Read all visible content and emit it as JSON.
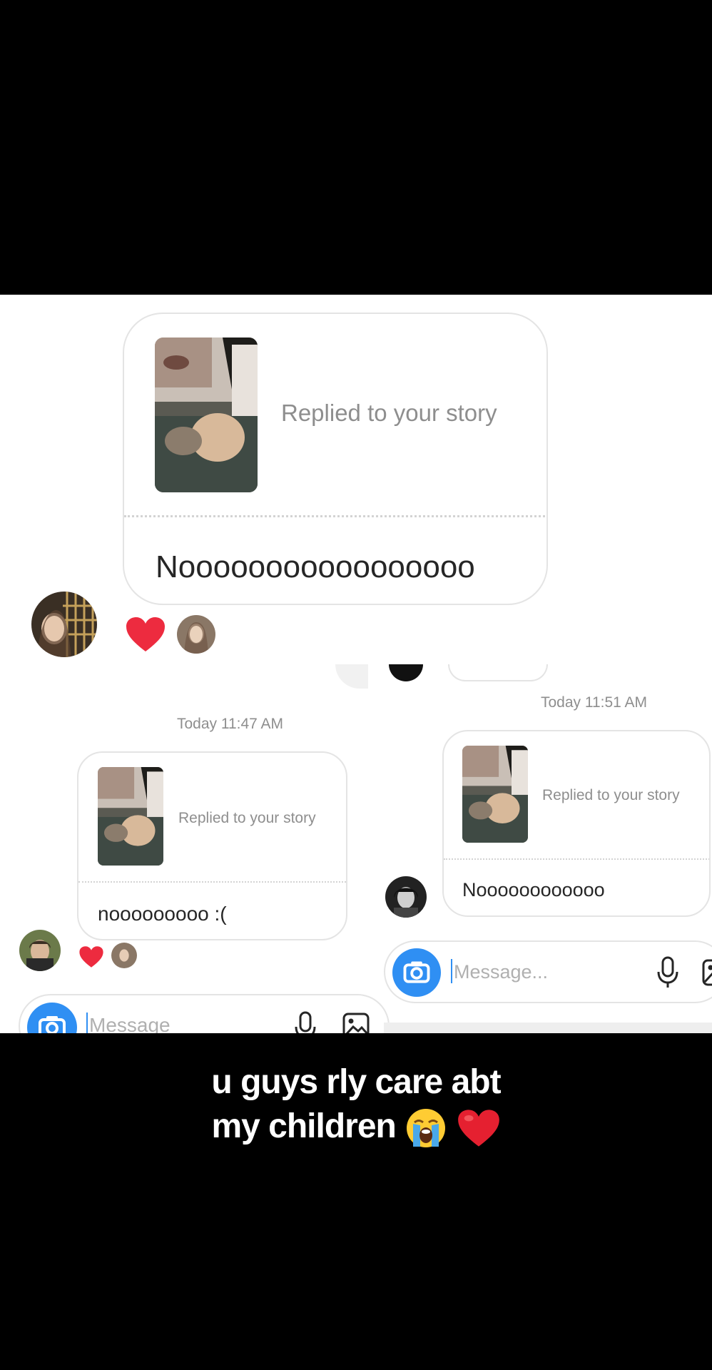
{
  "top_thread": {
    "reply_label": "Replied to your story",
    "message": "Nooooooooooooooooo"
  },
  "left_thread": {
    "timestamp": "Today 11:47 AM",
    "reply_label": "Replied to your story",
    "message": "nooooooooo :(",
    "composer_placeholder": "Message"
  },
  "right_thread": {
    "timestamp": "Today 11:51 AM",
    "reply_label": "Replied to your story",
    "message": "Noooooooooooo",
    "composer_placeholder": "Message..."
  },
  "caption": {
    "line1": "u guys rly care abt",
    "line2": "my children"
  },
  "icons": {
    "reaction": "heart-icon",
    "camera": "camera-icon",
    "microphone": "microphone-icon",
    "gallery": "gallery-icon",
    "crying_emoji": "loudly-crying-face-emoji",
    "heart_emoji": "red-heart-emoji"
  },
  "colors": {
    "heart_red": "#ed2b3f",
    "camera_blue": "#2f8ff3",
    "muted_text": "#8e8e8e"
  }
}
